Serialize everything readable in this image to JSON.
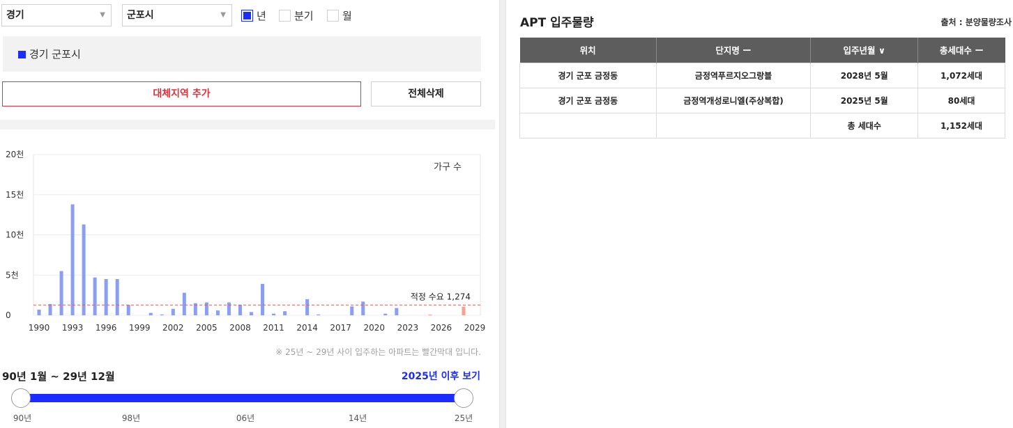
{
  "filters": {
    "province": "경기",
    "city": "군포시",
    "period_options": [
      {
        "label": "년",
        "checked": true
      },
      {
        "label": "분기",
        "checked": false
      },
      {
        "label": "월",
        "checked": false
      }
    ]
  },
  "selected_region": "경기 군포시",
  "buttons": {
    "add_region": "대체지역 추가",
    "delete_all": "전체삭제"
  },
  "chart_data": {
    "type": "bar",
    "series_label": "가구 수",
    "y_ticks": [
      "0",
      "5천",
      "10천",
      "15천",
      "20천"
    ],
    "ylim": [
      0,
      20000
    ],
    "x_tick_labels": [
      "1990",
      "1993",
      "1996",
      "1999",
      "2002",
      "2005",
      "2008",
      "2011",
      "2014",
      "2017",
      "2020",
      "2023",
      "2026",
      "2029"
    ],
    "bars": [
      {
        "year": 1990,
        "value": 700
      },
      {
        "year": 1991,
        "value": 1400
      },
      {
        "year": 1992,
        "value": 5500
      },
      {
        "year": 1993,
        "value": 13800
      },
      {
        "year": 1994,
        "value": 11300
      },
      {
        "year": 1995,
        "value": 4700
      },
      {
        "year": 1996,
        "value": 4500
      },
      {
        "year": 1997,
        "value": 4500
      },
      {
        "year": 1998,
        "value": 1300
      },
      {
        "year": 2000,
        "value": 300
      },
      {
        "year": 2001,
        "value": 100
      },
      {
        "year": 2002,
        "value": 800
      },
      {
        "year": 2003,
        "value": 2800
      },
      {
        "year": 2004,
        "value": 1500
      },
      {
        "year": 2005,
        "value": 1600
      },
      {
        "year": 2006,
        "value": 600
      },
      {
        "year": 2007,
        "value": 1600
      },
      {
        "year": 2008,
        "value": 1300
      },
      {
        "year": 2009,
        "value": 400
      },
      {
        "year": 2010,
        "value": 3900
      },
      {
        "year": 2011,
        "value": 200
      },
      {
        "year": 2012,
        "value": 500
      },
      {
        "year": 2014,
        "value": 2000
      },
      {
        "year": 2015,
        "value": 100
      },
      {
        "year": 2018,
        "value": 1100
      },
      {
        "year": 2019,
        "value": 1700
      },
      {
        "year": 2021,
        "value": 200
      },
      {
        "year": 2022,
        "value": 900
      },
      {
        "year": 2025,
        "value": 80,
        "highlight": true
      },
      {
        "year": 2028,
        "value": 1072,
        "highlight": true
      }
    ],
    "reference_line": {
      "value": 1274,
      "label": "적정 수요 1,274"
    },
    "colors": {
      "bar": "#8c9ef2",
      "highlight": "#f4a48e",
      "reference": "#e45a5a"
    }
  },
  "chart_note": "※ 25년 ~ 29년 사이 입주하는 아파트는 빨간막대 입니다.",
  "range": {
    "label": "90년 1월 ~ 29년 12월",
    "after_link": "2025년 이후 보기",
    "ticks": [
      "90년",
      "98년",
      "06년",
      "14년",
      "25년"
    ]
  },
  "apt": {
    "title": "APT 입주물량",
    "source": "출처 : 분양물량조사",
    "columns": [
      "위치",
      "단지명 ー",
      "입주년월 ∨",
      "총세대수 ー"
    ],
    "rows": [
      [
        "경기 군포 금정동",
        "금정역푸르지오그랑블",
        "2028년 5월",
        "1,072세대"
      ],
      [
        "경기 군포 금정동",
        "금정역개성로니엘(주상복합)",
        "2025년 5월",
        "80세대"
      ]
    ],
    "total_label": "총 세대수",
    "total_value": "1,152세대"
  }
}
